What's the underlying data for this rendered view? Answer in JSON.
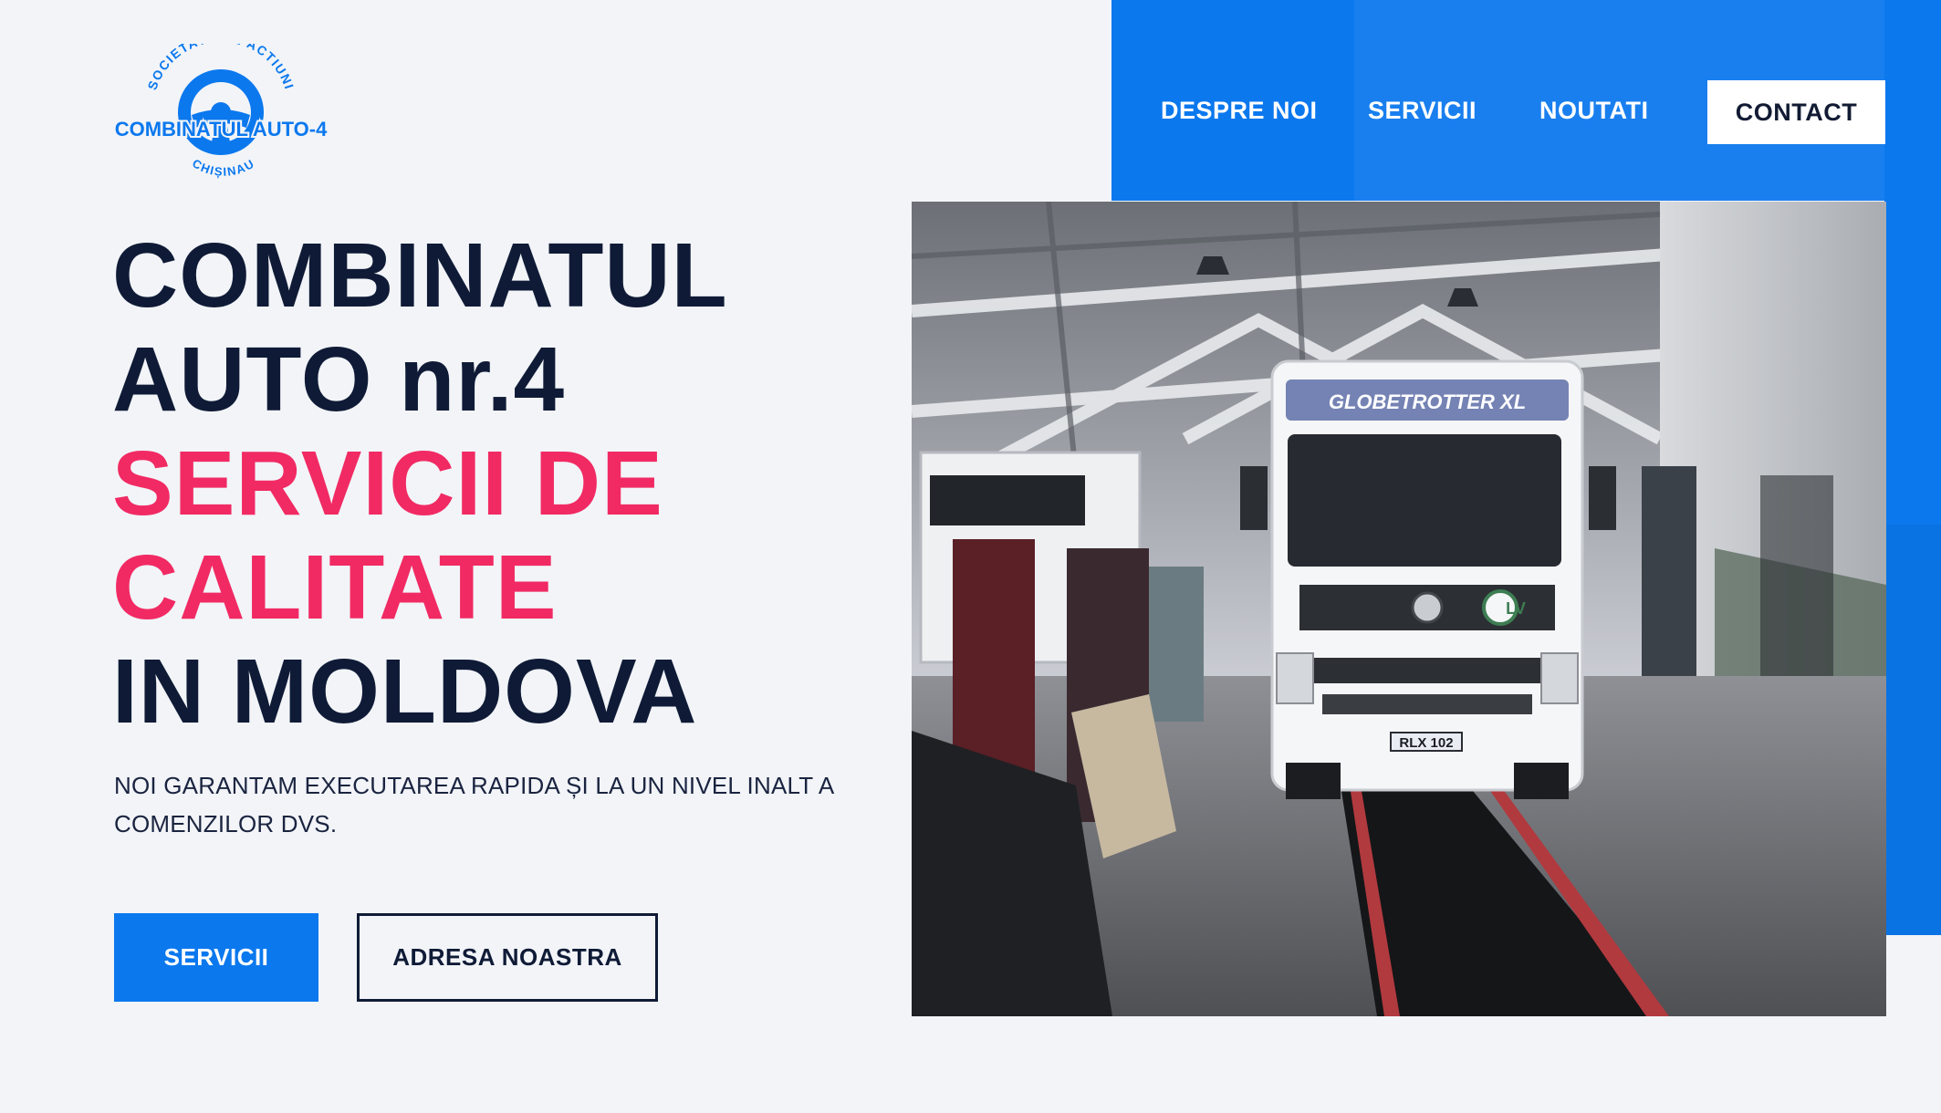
{
  "colors": {
    "brand_blue": "#0b78ee",
    "navy": "#0f1b36",
    "accent_pink": "#f12a63",
    "background": "#f2f4f8"
  },
  "logo": {
    "arc_top": "SOCIETATE PE ACTIUNI",
    "name": "COMBINATUL AUTO-4",
    "arc_bottom": "CHIȘINAU",
    "icon": "steering-wheel-icon"
  },
  "nav": {
    "items": [
      {
        "label": "DESPRE NOI"
      },
      {
        "label": "SERVICII"
      },
      {
        "label": "NOUTATI"
      }
    ],
    "contact_label": "CONTACT"
  },
  "hero": {
    "title_line1": "COMBINATUL",
    "title_line2": "AUTO nr.4",
    "accent_line1": "SERVICII DE",
    "accent_line2": "CALITATE",
    "title_line3": "IN MOLDOVA",
    "subtitle": "NOI GARANTAM EXECUTAREA RAPIDA ȘI LA UN NIVEL INALT A COMENZILOR DVS.",
    "primary_button": "SERVICII",
    "secondary_button": "ADRESA NOASTRA"
  },
  "photo": {
    "truck_visor_text": "GLOBETROTTER XL",
    "plate_text": "RLX 102",
    "badge_text": "LV"
  }
}
